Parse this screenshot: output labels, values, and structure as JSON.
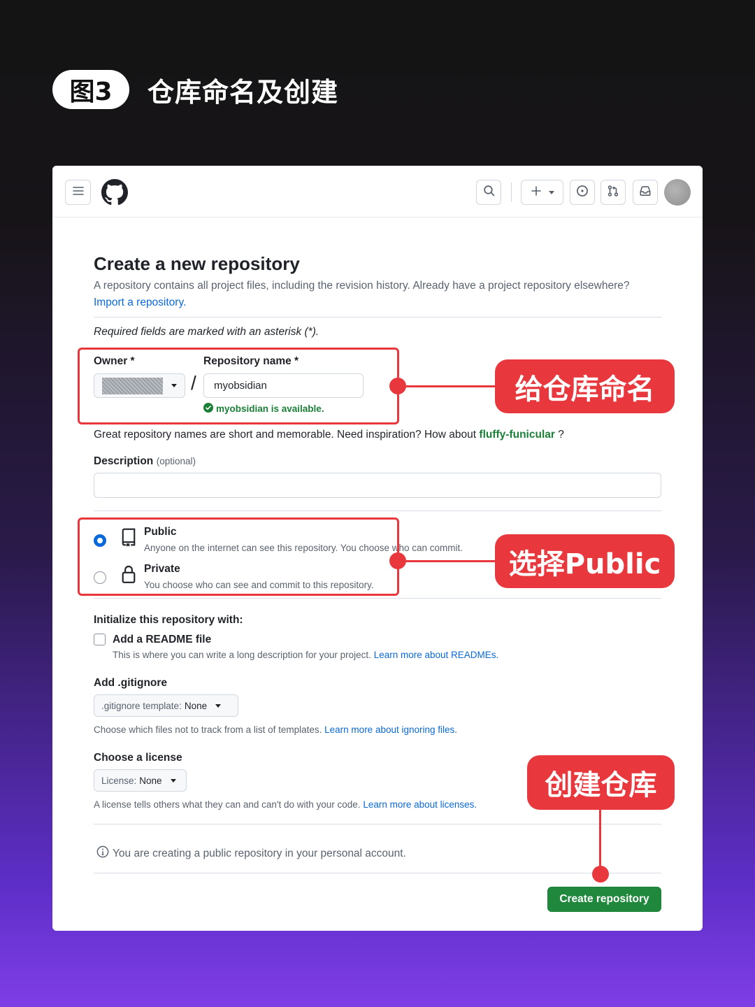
{
  "figure": {
    "badge": "图3",
    "title": "仓库命名及创建"
  },
  "page": {
    "title": "Create a new repository",
    "intro_text": "A repository contains all project files, including the revision history. Already have a project repository elsewhere?",
    "import_link": "Import a repository.",
    "required_note": "Required fields are marked with an asterisk (*)."
  },
  "owner": {
    "label": "Owner *"
  },
  "repo": {
    "label": "Repository name *",
    "value": "myobsidian",
    "availability": "myobsidian is available.",
    "slash": "/",
    "inspiration_text": "Great repository names are short and memorable. Need inspiration? How about",
    "suggestion": "fluffy-funicular",
    "suggestion_suffix": "?"
  },
  "description": {
    "label": "Description",
    "optional": "(optional)",
    "value": ""
  },
  "visibility": {
    "selected": "Public",
    "options": [
      {
        "title": "Public",
        "desc": "Anyone on the internet can see this repository. You choose who can commit."
      },
      {
        "title": "Private",
        "desc": "You choose who can see and commit to this repository."
      }
    ]
  },
  "initialize": {
    "heading": "Initialize this repository with:",
    "readme_label": "Add a README file",
    "readme_checked": false,
    "readme_desc": "This is where you can write a long description for your project.",
    "readme_link": "Learn more about READMEs."
  },
  "gitignore": {
    "heading": "Add .gitignore",
    "select_prefix": ".gitignore template:",
    "select_value": "None",
    "desc": "Choose which files not to track from a list of templates.",
    "link": "Learn more about ignoring files."
  },
  "license": {
    "heading": "Choose a license",
    "select_prefix": "License:",
    "select_value": "None",
    "desc": "A license tells others what they can and can't do with your code.",
    "link": "Learn more about licenses."
  },
  "notice": "You are creating a public repository in your personal account.",
  "create_button": "Create repository",
  "annotations": {
    "name_callout": "给仓库命名",
    "public_callout": "选择Public",
    "create_callout": "创建仓库",
    "color": "#e8383d"
  },
  "colors": {
    "primary_button": "#1f883d",
    "link": "#0969da",
    "success": "#1a7f37"
  },
  "icons": [
    "hamburger-icon",
    "github-logo-icon",
    "search-icon",
    "plus-icon",
    "issues-icon",
    "pull-request-icon",
    "inbox-icon",
    "repo-icon",
    "lock-icon",
    "check-circle-icon",
    "info-icon"
  ]
}
